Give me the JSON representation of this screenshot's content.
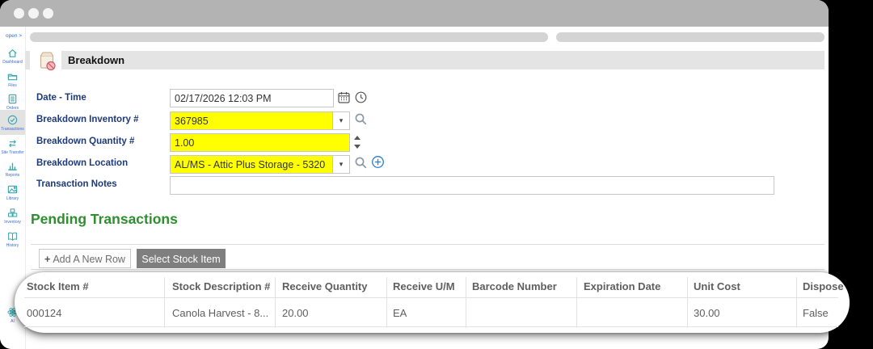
{
  "window": {
    "titlebar_color": "#b3b3b3"
  },
  "sidebar": {
    "open_label": "open >",
    "items": [
      {
        "label": "Dashboard",
        "icon": "home-icon"
      },
      {
        "label": "Files",
        "icon": "folder-icon"
      },
      {
        "label": "Orders",
        "icon": "document-icon"
      },
      {
        "label": "Transactions",
        "icon": "check-circle-icon",
        "active": true
      },
      {
        "label": "Site Transfer",
        "icon": "transfer-arrows-icon"
      },
      {
        "label": "Reports",
        "icon": "bar-chart-icon"
      },
      {
        "label": "Library",
        "icon": "image-icon"
      },
      {
        "label": "Inventory",
        "icon": "boxes-icon"
      },
      {
        "label": "History",
        "icon": "book-icon"
      }
    ],
    "ai_label": "AI"
  },
  "header": {
    "title": "Breakdown",
    "icon": "package-bag-icon"
  },
  "form": {
    "fields": [
      {
        "label": "Date - Time",
        "value": "02/17/2026 12:03 PM",
        "highlight": false
      },
      {
        "label": "Breakdown Inventory #",
        "value": "367985",
        "highlight": true
      },
      {
        "label": "Breakdown Quantity #",
        "value": "1.00",
        "highlight": true
      },
      {
        "label": "Breakdown Location",
        "value": "AL/MS - Attic Plus Storage - 5320",
        "highlight": true
      },
      {
        "label": "Transaction Notes",
        "value": "",
        "highlight": false
      }
    ],
    "highlight_color": "#ffff00"
  },
  "pending": {
    "heading": "Pending Transactions",
    "heading_color": "#2e8f2e",
    "add_row_label": "Add A New Row",
    "add_row_plus": "+",
    "select_stock_label": "Select Stock Item",
    "select_stock_bg": "#7f7f7f"
  },
  "table": {
    "columns": [
      "Stock Item #",
      "Stock Description #",
      "Receive Quantity",
      "Receive U/M",
      "Barcode Number",
      "Expiration Date",
      "Unit Cost",
      "Dispose"
    ],
    "rows": [
      [
        "000124",
        "Canola Harvest - 8...",
        "20.00",
        "EA",
        "",
        "",
        "30.00",
        "False"
      ]
    ]
  },
  "glyphs": {
    "dropdown_caret": "▾"
  }
}
